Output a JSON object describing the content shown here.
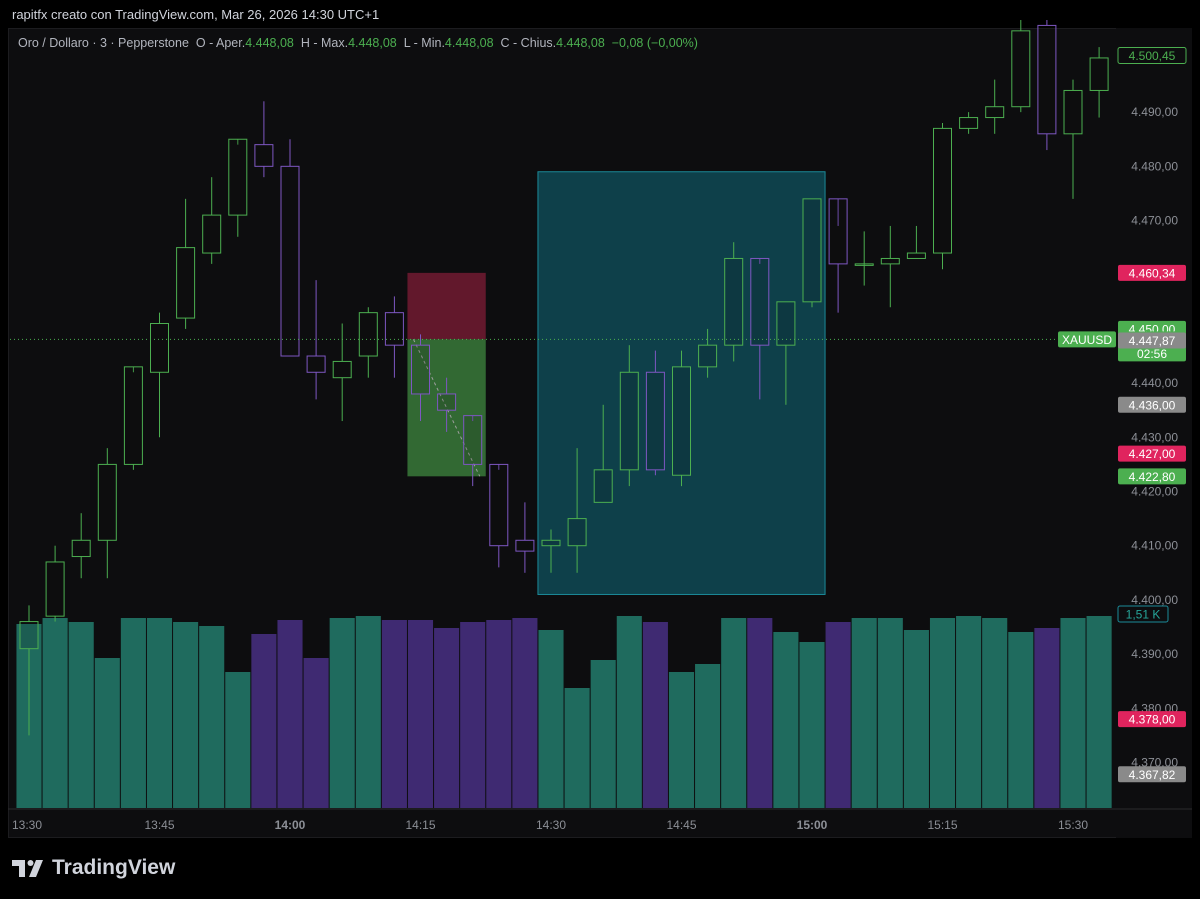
{
  "caption": "rapitfx creato con TradingView.com, Mar 26, 2026 14:30 UTC+1",
  "legend": {
    "symbol": "Oro / Dollaro · 3 · Pepperstone",
    "open_label": "O - Aper.",
    "open_value": "4.448,08",
    "high_label": "H - Max.",
    "high_value": "4.448,08",
    "low_label": "L - Min.",
    "low_value": "4.448,08",
    "close_label": "C - Chius.",
    "close_value": "4.448,08",
    "change": "−0,08 (−0,00%)"
  },
  "footer": {
    "brand": "TradingView"
  },
  "colors": {
    "up": "#4caf50",
    "down": "#7e57c2",
    "vol_up": "#1f6b5e",
    "vol_down": "#3f2a72",
    "range_box": "#0f4a55",
    "stop_zone": "#6b1a30",
    "target_zone": "#3a7a3a"
  },
  "chart_data": {
    "type": "candlestick",
    "symbol": "XAUUSD",
    "interval": "3",
    "ylim": [
      4364,
      4507
    ],
    "y_ticks": [
      "4.490,00",
      "4.480,00",
      "4.470,00",
      "4.450,00",
      "4.440,00",
      "4.430,00",
      "4.420,00",
      "4.410,00",
      "4.400,00",
      "4.390,00",
      "4.380,00",
      "4.370,00"
    ],
    "y_tick_values": [
      4490,
      4480,
      4470,
      4450,
      4440,
      4430,
      4420,
      4410,
      4400,
      4390,
      4380,
      4370
    ],
    "x_ticks": [
      {
        "label": "13:30",
        "bar": 0,
        "bold": false
      },
      {
        "label": "13:45",
        "bar": 5,
        "bold": false
      },
      {
        "label": "14:00",
        "bar": 10,
        "bold": true
      },
      {
        "label": "14:15",
        "bar": 15,
        "bold": false
      },
      {
        "label": "14:30",
        "bar": 20,
        "bold": false
      },
      {
        "label": "14:45",
        "bar": 25,
        "bold": false
      },
      {
        "label": "15:00",
        "bar": 30,
        "bold": true
      },
      {
        "label": "15:15",
        "bar": 35,
        "bold": false
      },
      {
        "label": "15:30",
        "bar": 40,
        "bold": false
      }
    ],
    "candles": [
      {
        "t": "13:30",
        "o": 4391,
        "h": 4399,
        "l": 4375,
        "c": 4396
      },
      {
        "t": "13:33",
        "o": 4397,
        "h": 4410,
        "l": 4396,
        "c": 4407
      },
      {
        "t": "13:36",
        "o": 4408,
        "h": 4416,
        "l": 4404,
        "c": 4411
      },
      {
        "t": "13:39",
        "o": 4411,
        "h": 4428,
        "l": 4404,
        "c": 4425
      },
      {
        "t": "13:42",
        "o": 4425,
        "h": 4442,
        "l": 4424,
        "c": 4443
      },
      {
        "t": "13:45",
        "o": 4442,
        "h": 4453,
        "l": 4430,
        "c": 4451
      },
      {
        "t": "13:48",
        "o": 4452,
        "h": 4474,
        "l": 4450,
        "c": 4465
      },
      {
        "t": "13:51",
        "o": 4464,
        "h": 4478,
        "l": 4462,
        "c": 4471
      },
      {
        "t": "13:54",
        "o": 4471,
        "h": 4484,
        "l": 4467,
        "c": 4485
      },
      {
        "t": "13:57",
        "o": 4484,
        "h": 4492,
        "l": 4478,
        "c": 4480
      },
      {
        "t": "14:00",
        "o": 4480,
        "h": 4485,
        "l": 4445,
        "c": 4445
      },
      {
        "t": "14:03",
        "o": 4445,
        "h": 4459,
        "l": 4437,
        "c": 4442
      },
      {
        "t": "14:06",
        "o": 4441,
        "h": 4451,
        "l": 4433,
        "c": 4444
      },
      {
        "t": "14:09",
        "o": 4445,
        "h": 4454,
        "l": 4441,
        "c": 4453
      },
      {
        "t": "14:12",
        "o": 4453,
        "h": 4456,
        "l": 4441,
        "c": 4447
      },
      {
        "t": "14:15",
        "o": 4447,
        "h": 4449,
        "l": 4433,
        "c": 4438
      },
      {
        "t": "14:18",
        "o": 4438,
        "h": 4441,
        "l": 4431,
        "c": 4435
      },
      {
        "t": "14:21",
        "o": 4434,
        "h": 4433,
        "l": 4421,
        "c": 4425
      },
      {
        "t": "14:24",
        "o": 4425,
        "h": 4424,
        "l": 4406,
        "c": 4410
      },
      {
        "t": "14:27",
        "o": 4411,
        "h": 4418,
        "l": 4405,
        "c": 4409
      },
      {
        "t": "14:30",
        "o": 4410,
        "h": 4413,
        "l": 4405,
        "c": 4411
      },
      {
        "t": "14:33",
        "o": 4410,
        "h": 4428,
        "l": 4405,
        "c": 4415
      },
      {
        "t": "14:36",
        "o": 4418,
        "h": 4436,
        "l": 4418,
        "c": 4424
      },
      {
        "t": "14:39",
        "o": 4424,
        "h": 4447,
        "l": 4421,
        "c": 4442
      },
      {
        "t": "14:42",
        "o": 4442,
        "h": 4446,
        "l": 4423,
        "c": 4424
      },
      {
        "t": "14:45",
        "o": 4423,
        "h": 4446,
        "l": 4421,
        "c": 4443
      },
      {
        "t": "14:48",
        "o": 4443,
        "h": 4450,
        "l": 4441,
        "c": 4447
      },
      {
        "t": "14:51",
        "o": 4447,
        "h": 4466,
        "l": 4444,
        "c": 4463
      },
      {
        "t": "14:54",
        "o": 4463,
        "h": 4462,
        "l": 4437,
        "c": 4447
      },
      {
        "t": "14:57",
        "o": 4447,
        "h": 4455,
        "l": 4436,
        "c": 4455
      },
      {
        "t": "15:00",
        "o": 4455,
        "h": 4474,
        "l": 4454,
        "c": 4474
      },
      {
        "t": "15:03",
        "o": 4474,
        "h": 4469,
        "l": 4453,
        "c": 4462
      },
      {
        "t": "15:06",
        "o": 4462,
        "h": 4468,
        "l": 4458,
        "c": 4462
      },
      {
        "t": "15:09",
        "o": 4462,
        "h": 4469,
        "l": 4454,
        "c": 4463
      },
      {
        "t": "15:12",
        "o": 4463,
        "h": 4469,
        "l": 4463,
        "c": 4464
      },
      {
        "t": "15:15",
        "o": 4464,
        "h": 4488,
        "l": 4461,
        "c": 4487
      },
      {
        "t": "15:18",
        "o": 4487,
        "h": 4490,
        "l": 4486,
        "c": 4489
      },
      {
        "t": "15:21",
        "o": 4489,
        "h": 4496,
        "l": 4486,
        "c": 4491
      },
      {
        "t": "15:24",
        "o": 4491,
        "h": 4507,
        "l": 4490,
        "c": 4505
      },
      {
        "t": "15:27",
        "o": 4506,
        "h": 4507,
        "l": 4483,
        "c": 4486
      },
      {
        "t": "15:30",
        "o": 4486,
        "h": 4496,
        "l": 4474,
        "c": 4494
      },
      {
        "t": "15:33",
        "o": 4494,
        "h": 4502,
        "l": 4489,
        "c": 4500
      }
    ],
    "volume_fraction": [
      0.92,
      0.95,
      0.93,
      0.75,
      0.95,
      0.95,
      0.93,
      0.91,
      0.68,
      0.87,
      0.94,
      0.75,
      0.95,
      0.96,
      0.94,
      0.94,
      0.9,
      0.93,
      0.94,
      0.95,
      0.89,
      0.6,
      0.74,
      0.96,
      0.93,
      0.68,
      0.72,
      0.95,
      0.95,
      0.88,
      0.83,
      0.93,
      0.95,
      0.95,
      0.89,
      0.95,
      0.96,
      0.95,
      0.88,
      0.9,
      0.95,
      0.96
    ],
    "volume_label": "1,51 K",
    "current_price_line": 4448.08,
    "position_tool": {
      "start_bar": 15,
      "end_bar": 17,
      "entry": 4448.08,
      "stop": 4460.34,
      "target": 4422.8
    },
    "range_box": {
      "start_bar": 20,
      "end_bar": 30,
      "top": 4479,
      "bottom": 4401
    },
    "price_labels": [
      {
        "value": 4500.45,
        "text": "4.500,45",
        "style": "outline-green"
      },
      {
        "value": 4460.34,
        "text": "4.460,34",
        "style": "red"
      },
      {
        "value": 4450.0,
        "text": "4.450,00",
        "style": "green"
      },
      {
        "value": 4448.08,
        "text": "4.448,08",
        "style": "green"
      },
      {
        "value": 4446.5,
        "text": "02:56",
        "style": "green"
      },
      {
        "value": 4447.87,
        "text": "4.447,87",
        "style": "gray"
      },
      {
        "value": 4436.0,
        "text": "4.436,00",
        "style": "gray"
      },
      {
        "value": 4427.0,
        "text": "4.427,00",
        "style": "red"
      },
      {
        "value": 4422.8,
        "text": "4.422,80",
        "style": "green"
      },
      {
        "value": 4378.0,
        "text": "4.378,00",
        "style": "red"
      },
      {
        "value": 4367.82,
        "text": "4.367,82",
        "style": "gray"
      }
    ],
    "symbol_tag": "XAUUSD"
  }
}
